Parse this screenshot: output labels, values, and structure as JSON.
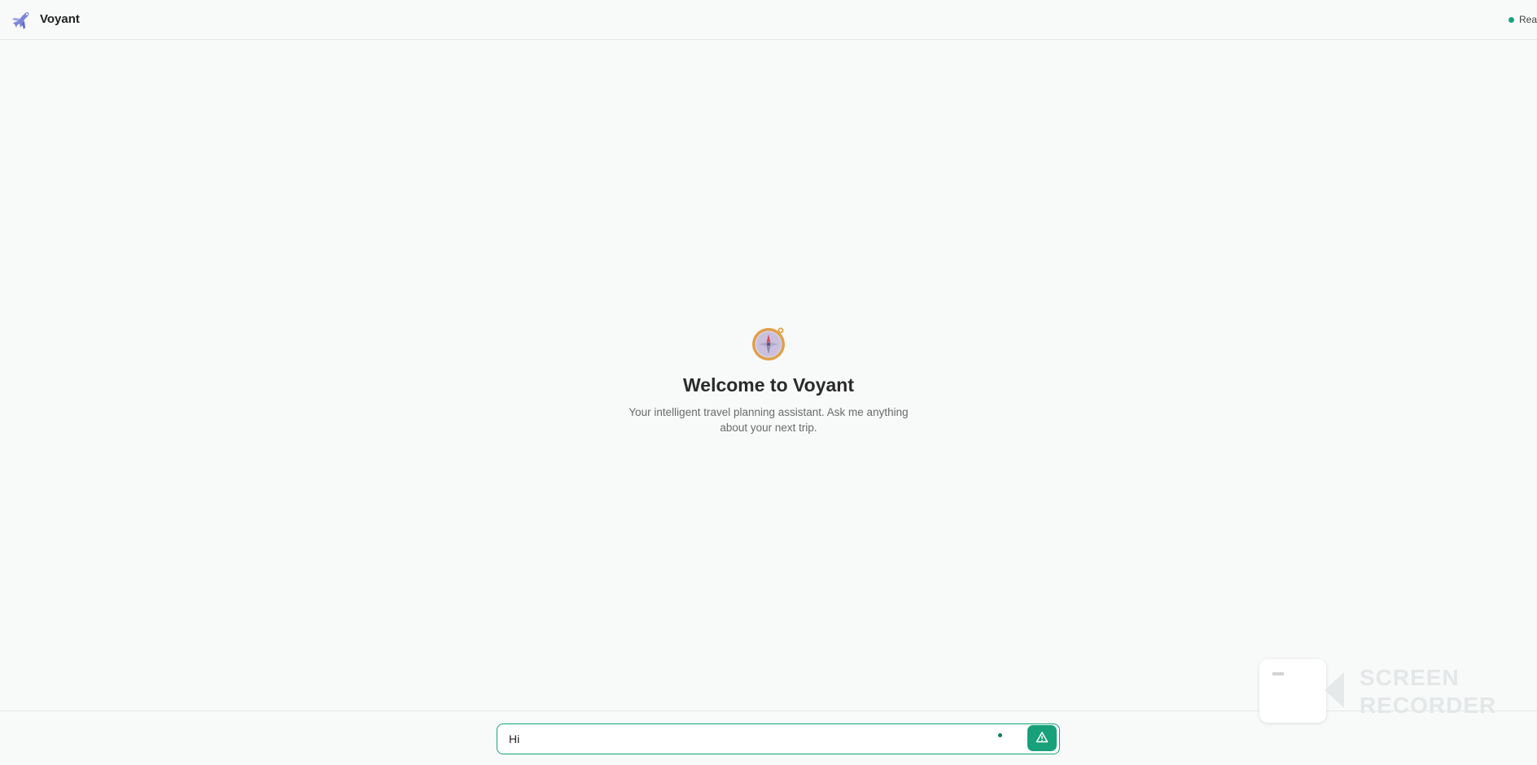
{
  "header": {
    "app_title": "Voyant",
    "status_text": "Rea",
    "logo_icon": "airplane-icon"
  },
  "welcome": {
    "icon": "compass-icon",
    "title": "Welcome to Voyant",
    "subtitle": "Your intelligent travel planning assistant. Ask me anything about your next trip."
  },
  "chat": {
    "input_value": "Hi",
    "send_icon": "warning-triangle-icon"
  },
  "watermark": {
    "line1": "SCREEN",
    "line2": "RECORDER"
  },
  "colors": {
    "accent": "#16a37a",
    "background": "#f8f9f9"
  }
}
